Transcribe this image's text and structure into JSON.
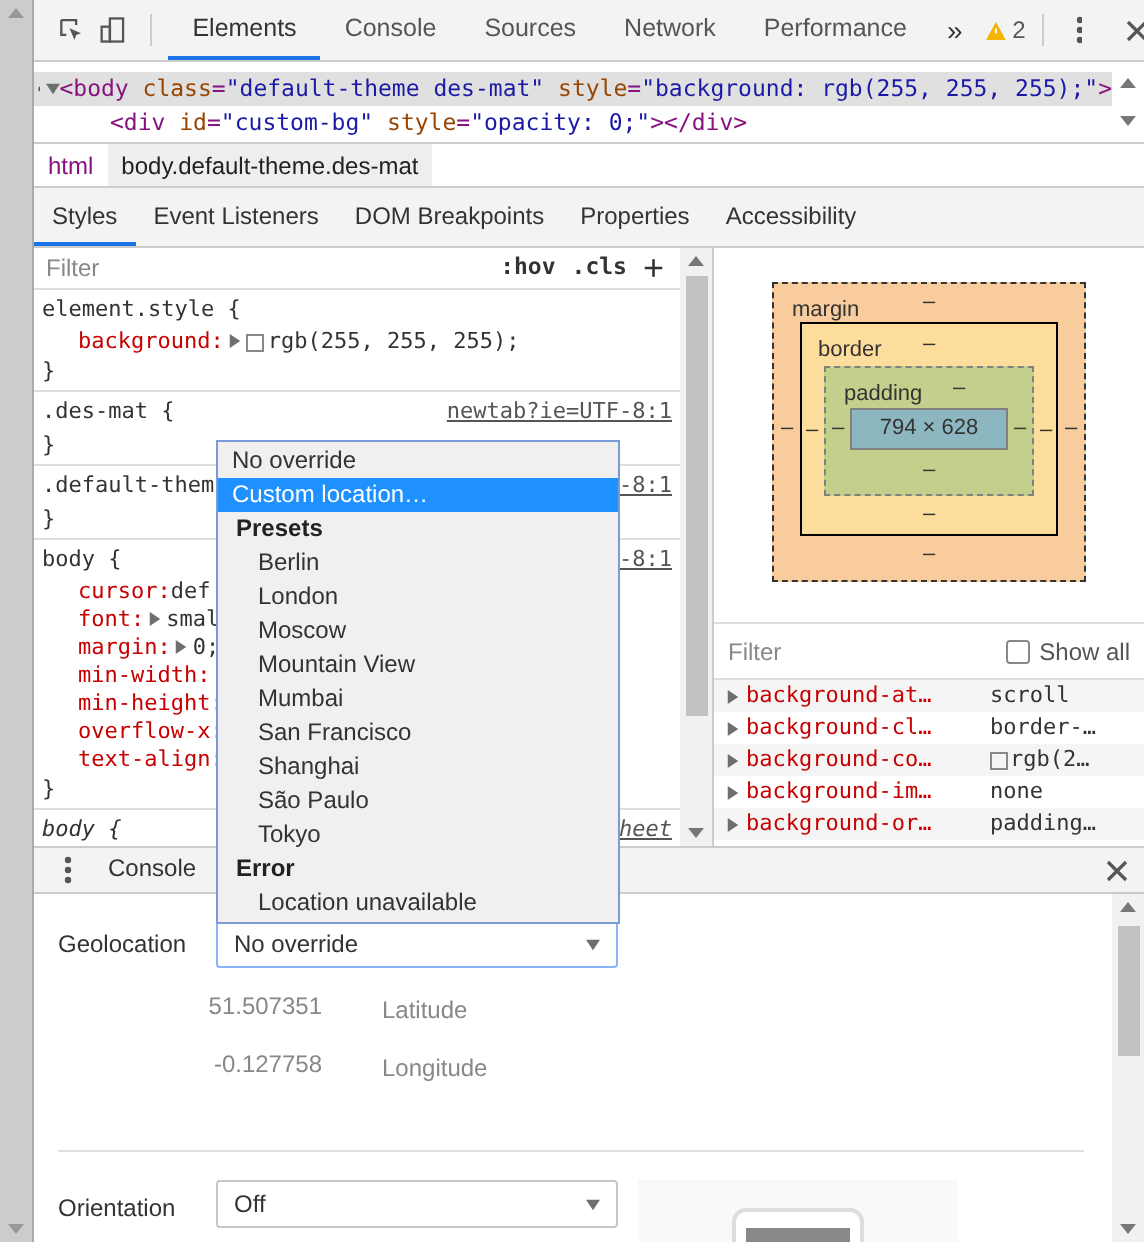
{
  "toolbar": {
    "tabs": [
      {
        "label": "Elements",
        "selected": true
      },
      {
        "label": "Console",
        "selected": false
      },
      {
        "label": "Sources",
        "selected": false
      },
      {
        "label": "Network",
        "selected": false
      },
      {
        "label": "Performance",
        "selected": false
      }
    ],
    "more": "»",
    "warnings": "2"
  },
  "dom": {
    "lines": [
      {
        "selected": true,
        "expanded": true,
        "tokens": [
          {
            "kind": "tag",
            "text": "<body"
          },
          {
            "kind": "attr",
            "text": " class"
          },
          {
            "kind": "tag",
            "text": "="
          },
          {
            "kind": "value",
            "text": "\"default-theme des-mat\""
          },
          {
            "kind": "attr",
            "text": " style"
          },
          {
            "kind": "tag",
            "text": "="
          },
          {
            "kind": "value",
            "text": "\"background: rgb(255, 255, 255);\""
          },
          {
            "kind": "tag",
            "text": ">"
          }
        ]
      },
      {
        "selected": false,
        "tokens": [
          {
            "kind": "tag",
            "text": "<div"
          },
          {
            "kind": "attr",
            "text": " id"
          },
          {
            "kind": "tag",
            "text": "="
          },
          {
            "kind": "value",
            "text": "\"custom-bg\""
          },
          {
            "kind": "attr",
            "text": " style"
          },
          {
            "kind": "tag",
            "text": "="
          },
          {
            "kind": "value",
            "text": "\"opacity: 0;\""
          },
          {
            "kind": "tag",
            "text": "></div>"
          }
        ]
      }
    ]
  },
  "breadcrumbs": [
    {
      "label": "html",
      "selected": false
    },
    {
      "label": "body.default-theme.des-mat",
      "selected": true
    }
  ],
  "sidebar_tabs": [
    {
      "label": "Styles",
      "selected": true
    },
    {
      "label": "Event Listeners",
      "selected": false
    },
    {
      "label": "DOM Breakpoints",
      "selected": false
    },
    {
      "label": "Properties",
      "selected": false
    },
    {
      "label": "Accessibility",
      "selected": false
    }
  ],
  "styles": {
    "filter": {
      "placeholder": "Filter"
    },
    "hov": ":hov",
    "cls": ".cls",
    "add": "+",
    "rules": [
      {
        "selector": "element.style {",
        "italic": false,
        "props": [
          {
            "name": "background:",
            "value": "rgb(255, 255, 255);",
            "swatch": true,
            "expand": true
          }
        ],
        "close": "}"
      },
      {
        "selector": ".des-mat {",
        "source": "newtab?ie=UTF-8:1",
        "italic": false,
        "close": "}"
      },
      {
        "selector": ".default-them",
        "source": "-8:1",
        "italic": false,
        "close": "}"
      },
      {
        "selector": "body {",
        "source": "-8:1",
        "italic": false,
        "props": [
          {
            "name": "cursor:",
            "value": "def",
            "swatch": false,
            "expand": false
          },
          {
            "name": "font:",
            "value": "smal",
            "swatch": false,
            "expand": true
          },
          {
            "name": "margin:",
            "value": "0;",
            "swatch": false,
            "expand": true
          },
          {
            "name": "min-width:"
          },
          {
            "name": "min-height:"
          },
          {
            "name": "overflow-x:"
          },
          {
            "name": "text-align:"
          }
        ],
        "close": "}"
      },
      {
        "selector": "body {",
        "source": "heet",
        "italic": true
      }
    ]
  },
  "box_model": {
    "margin": "margin",
    "margin_top": "–",
    "margin_bottom": "–",
    "margin_left": "–",
    "margin_right": "–",
    "border": "border",
    "border_top": "–",
    "border_bottom": "–",
    "border_left": "–",
    "border_right": "–",
    "padding": "padding",
    "padding_top": "–",
    "padding_bottom": "–",
    "padding_left": "–",
    "padding_right": "–",
    "content": "794 × 628"
  },
  "computed": {
    "filter": {
      "placeholder": "Filter"
    },
    "show_all": {
      "label": "Show all",
      "checked": false
    },
    "rows": [
      {
        "name": "background-at…",
        "value": "scroll",
        "swatch": false
      },
      {
        "name": "background-cl…",
        "value": "border-…",
        "swatch": false
      },
      {
        "name": "background-co…",
        "value": "rgb(2…",
        "swatch": true
      },
      {
        "name": "background-im…",
        "value": "none",
        "swatch": false
      },
      {
        "name": "background-or…",
        "value": "padding…",
        "swatch": false
      }
    ]
  },
  "dropdown": {
    "items": [
      {
        "kind": "option",
        "label": "No override",
        "selected": false
      },
      {
        "kind": "option",
        "label": "Custom location…",
        "selected": true
      },
      {
        "kind": "group",
        "label": "Presets"
      },
      {
        "kind": "child",
        "label": "Berlin",
        "selected": false
      },
      {
        "kind": "child",
        "label": "London",
        "selected": false
      },
      {
        "kind": "child",
        "label": "Moscow",
        "selected": false
      },
      {
        "kind": "child",
        "label": "Mountain View",
        "selected": false
      },
      {
        "kind": "child",
        "label": "Mumbai",
        "selected": false
      },
      {
        "kind": "child",
        "label": "San Francisco",
        "selected": false
      },
      {
        "kind": "child",
        "label": "Shanghai",
        "selected": false
      },
      {
        "kind": "child",
        "label": "São Paulo",
        "selected": false
      },
      {
        "kind": "child",
        "label": "Tokyo",
        "selected": false
      },
      {
        "kind": "group",
        "label": "Error"
      },
      {
        "kind": "child",
        "label": "Location unavailable",
        "selected": false
      }
    ]
  },
  "drawer": {
    "tabs": [
      {
        "label": "Console",
        "selected": false
      }
    ],
    "geolocation": {
      "label": "Geolocation",
      "value": "No override",
      "latitude": "51.507351",
      "latitude_label": "Latitude",
      "longitude": "-0.127758",
      "longitude_label": "Longitude"
    },
    "orientation": {
      "label": "Orientation",
      "value": "Off"
    }
  }
}
